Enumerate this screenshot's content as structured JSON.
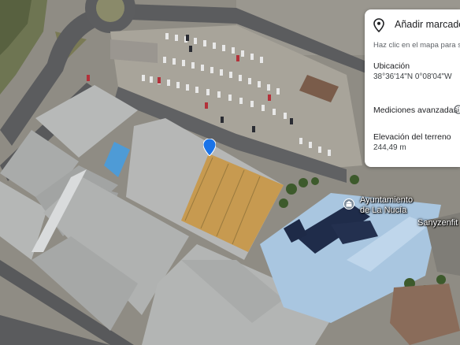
{
  "panel": {
    "title": "Añadir marcador",
    "hint": "Haz clic en el mapa para s",
    "location_label": "Ubicación",
    "location_value": "38°36'14\"N 0°08'04\"W",
    "advanced_label": "Mediciones avanzadas",
    "elevation_label": "Elevación del terreno",
    "elevation_value": "244,49 m"
  },
  "map": {
    "poi_label_line1": "Ayuntamiento",
    "poi_label_line2": "de La Nucía",
    "business_label": "Sanyzenfit",
    "marker_color": "#1a73e8"
  },
  "icons": {
    "panel_pin": "place-pin-icon",
    "info": "info-icon",
    "poi": "town-hall-icon",
    "marker": "location-marker-icon"
  }
}
